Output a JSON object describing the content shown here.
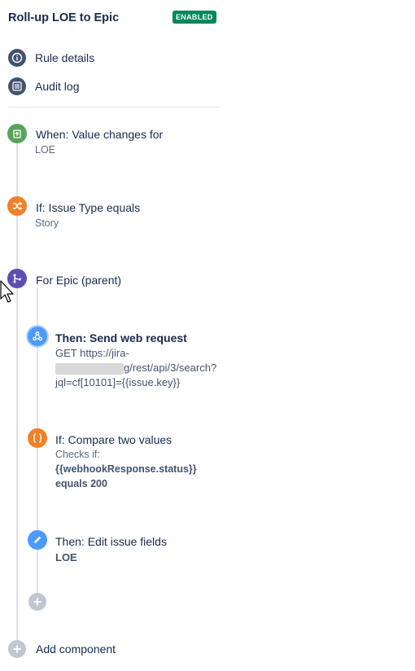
{
  "header": {
    "title": "Roll-up LOE to Epic",
    "status_badge": "ENABLED"
  },
  "nav": {
    "rule_details": "Rule details",
    "audit_log": "Audit log"
  },
  "steps": {
    "trigger": {
      "title": "When: Value changes for",
      "value": "LOE"
    },
    "condition": {
      "title": "If: Issue Type equals",
      "value": "Story"
    },
    "branch": {
      "title": "For Epic (parent)"
    },
    "web_request": {
      "title": "Then: Send web request",
      "line1": "GET https://jira-",
      "line2": "g/rest/api/3/search?",
      "line3": "jql=cf[10101]={{issue.key}}"
    },
    "compare": {
      "title": "If: Compare two values",
      "checks": "Checks if:",
      "expression": "{{webhookResponse.status}}",
      "equals": "equals 200"
    },
    "edit": {
      "title": "Then: Edit issue fields",
      "value": "LOE"
    }
  },
  "footer": {
    "add_component": "Add component"
  },
  "colors": {
    "enabled_badge": "#00875a",
    "trigger": "#57a55a",
    "condition": "#f0812a",
    "branch": "#5e4db2",
    "action": "#4c9aff",
    "add": "#c1c7d0"
  }
}
